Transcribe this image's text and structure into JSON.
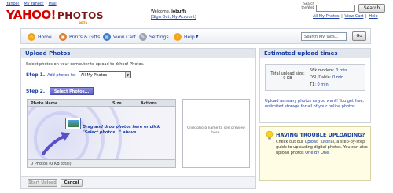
{
  "header": {
    "top_links": [
      "Yahoo!",
      "My Yahoo!",
      "Mail"
    ],
    "logo_yahoo": "YAHOO!",
    "logo_photos": "PHOTOS",
    "logo_beta": "BETA",
    "welcome": "Welcome,",
    "username": "iobuffs",
    "signout": "[Sign Out, My Account]",
    "search_label": "Search the Web",
    "search_button": "Search",
    "util_links": [
      "All My Photos",
      "View Cart",
      "Help"
    ]
  },
  "nav": {
    "items": [
      {
        "label": "Home",
        "icon": "home-icon",
        "color": "#f1a51d"
      },
      {
        "label": "Prints & Gifts",
        "icon": "gift-icon",
        "color": "#e07a2c"
      },
      {
        "label": "View Cart",
        "icon": "cart-icon",
        "color": "#3a78c9"
      },
      {
        "label": "Settings",
        "icon": "wrench-icon",
        "color": "#9aa3b1"
      },
      {
        "label": "Help",
        "icon": "help-icon",
        "color": "#f1a51d"
      }
    ],
    "tag_search_placeholder": "Search My Tags...",
    "go_button": "Go"
  },
  "upload": {
    "title": "Upload Photos",
    "intro": "Select photos on your computer to upload to Yahoo! Photos.",
    "step1_num": "Step 1.",
    "step1_text": "Add photos to:",
    "album_value": "All My Photos",
    "step2_num": "Step 2.",
    "select_button": "Select Photos...",
    "columns": [
      "Photo Name",
      "Size",
      "Actions"
    ],
    "drop_text": "Drag and drop photos here or click \"Select photos...\" above.",
    "footer": "0 Photos (0 KB total)",
    "preview_text": "Click photo name to see preview here.",
    "start_button": "Start Upload",
    "cancel_button": "Cancel"
  },
  "times": {
    "title": "Estimated upload times",
    "size_label": "Total upload size:",
    "size_value": "0 KB",
    "rows": [
      {
        "label": "56k modem:",
        "value": "0 min."
      },
      {
        "label": "DSL/Cable:",
        "value": "0 min."
      },
      {
        "label": "T1:",
        "value": "0 min."
      }
    ],
    "note": "Upload as many photos as you want! You get free, unlimited storage for all of your online photos."
  },
  "trouble": {
    "title": "HAVING TROUBLE UPLOADING?",
    "body_prefix": "Check out our ",
    "body_link1": "Upload Tutorial",
    "body_middle": ", a step-by-step guide to uploading digital photos. You can also upload photos ",
    "body_link2": "One By One",
    "body_suffix": "."
  },
  "colors": {
    "brand_red": "#d60000",
    "link_blue": "#1b3ea3",
    "panel_header": "#e2e7ee",
    "select_button": "#6e70d6",
    "tip_background": "#fffde3"
  }
}
